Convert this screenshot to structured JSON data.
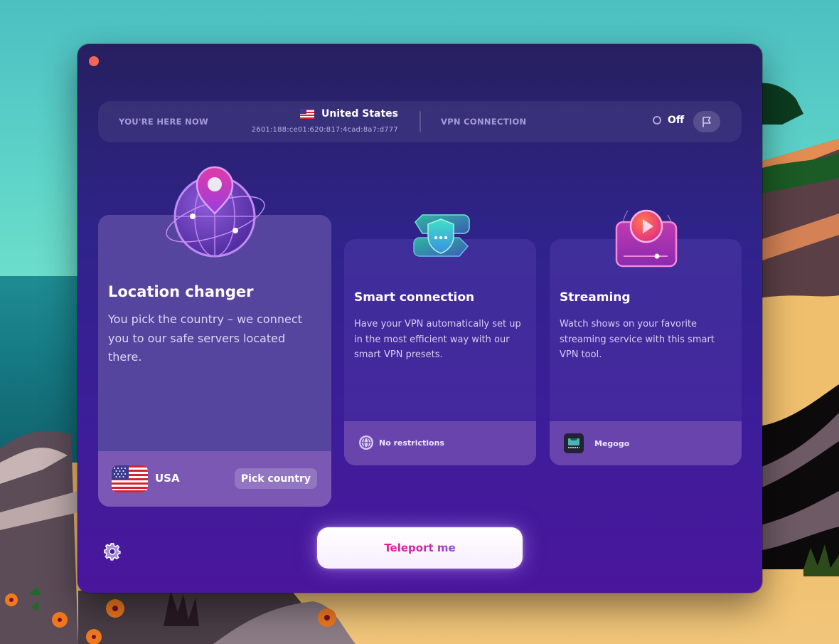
{
  "window": {
    "close_button": "close-window"
  },
  "status_bar": {
    "location_label": "YOU'RE HERE NOW",
    "country": "United States",
    "ip_address": "2601:188:ce01:620:817:4cad:8a7:d777",
    "vpn_label": "VPN CONNECTION",
    "vpn_state": "Off",
    "flag_icon": "flag-icon"
  },
  "cards": {
    "location": {
      "title": "Location changer",
      "description": "You pick the country – we connect you to our safe servers located there.",
      "selected_country": "USA",
      "pick_button": "Pick country",
      "icon": "globe-pin-icon"
    },
    "smart": {
      "title": "Smart connection",
      "description": "Have your VPN automatically set up in the most efficient way with our smart VPN presets.",
      "footer_label": "No restrictions",
      "footer_icon": "globe-icon",
      "icon": "shield-icon"
    },
    "streaming": {
      "title": "Streaming",
      "description": "Watch shows on your favorite streaming service with this smart VPN tool.",
      "footer_label": "Megogo",
      "footer_icon": "megogo-logo",
      "icon": "play-video-icon"
    }
  },
  "actions": {
    "teleport_label": "Teleport me",
    "settings_icon": "gear-icon"
  },
  "colors": {
    "accent_pink": "#e0218a",
    "window_bg": "#2f238a",
    "close_dot": "#f76557"
  }
}
